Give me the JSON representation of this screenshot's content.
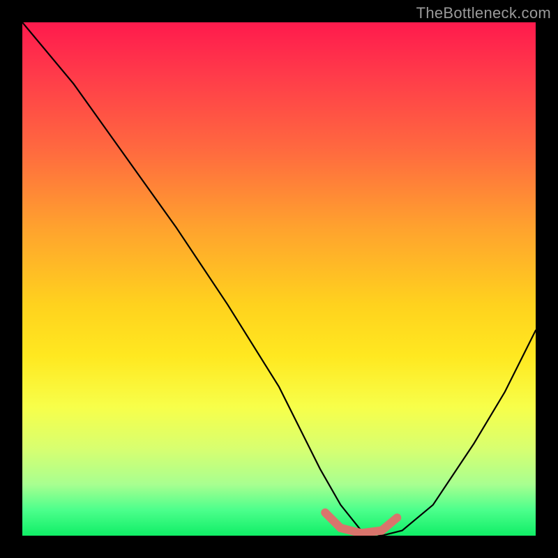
{
  "watermark": "TheBottleneck.com",
  "chart_data": {
    "type": "line",
    "title": "",
    "xlabel": "",
    "ylabel": "",
    "xlim": [
      0,
      100
    ],
    "ylim": [
      0,
      100
    ],
    "series": [
      {
        "name": "bottleneck-curve",
        "x": [
          0,
          10,
          20,
          30,
          40,
          50,
          58,
          62,
          66,
          70,
          74,
          80,
          88,
          94,
          100
        ],
        "y": [
          100,
          88,
          74,
          60,
          45,
          29,
          13,
          6,
          1,
          0,
          1,
          6,
          18,
          28,
          40
        ]
      }
    ],
    "highlight_segment": {
      "name": "min-plateau",
      "color": "#d9746c",
      "x": [
        59,
        62,
        66,
        70,
        73
      ],
      "y": [
        4.5,
        1.5,
        0.5,
        1.0,
        3.5
      ]
    },
    "gradient_stops": [
      {
        "pos": 0,
        "color": "#ff1a4d"
      },
      {
        "pos": 25,
        "color": "#ff6a3f"
      },
      {
        "pos": 55,
        "color": "#ffd21e"
      },
      {
        "pos": 75,
        "color": "#f7ff4a"
      },
      {
        "pos": 100,
        "color": "#10ee66"
      }
    ]
  }
}
